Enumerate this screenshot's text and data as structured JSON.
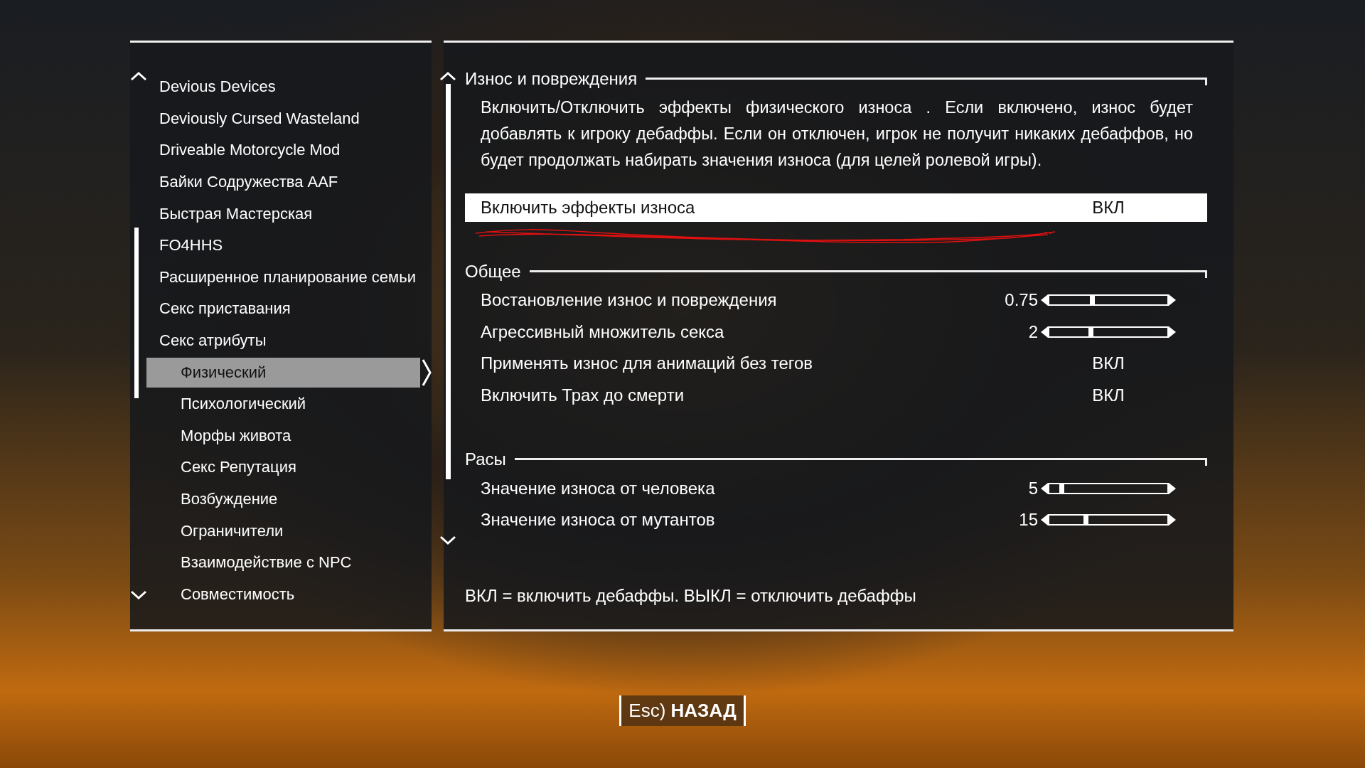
{
  "sidebar": {
    "items": [
      {
        "label": "Devious Devices",
        "selected": false
      },
      {
        "label": "Deviously Cursed Wasteland",
        "selected": false
      },
      {
        "label": "Driveable Motorcycle Mod",
        "selected": false
      },
      {
        "label": "Байки Содружества AAF",
        "selected": false
      },
      {
        "label": "Быстрая Мастерская",
        "selected": false
      },
      {
        "label": "FO4HHS",
        "selected": false
      },
      {
        "label": "Расширенное планирование семьи",
        "selected": false
      },
      {
        "label": "Секс приставания",
        "selected": false
      },
      {
        "label": "Секс атрибуты",
        "selected": false,
        "children": [
          {
            "label": "Физический",
            "selected": true
          },
          {
            "label": "Психологический",
            "selected": false
          },
          {
            "label": "Морфы живота",
            "selected": false
          },
          {
            "label": "Секс Репутация",
            "selected": false
          },
          {
            "label": "Возбуждение",
            "selected": false
          },
          {
            "label": "Ограничители",
            "selected": false
          },
          {
            "label": "Взаимодействие с NPC",
            "selected": false
          },
          {
            "label": "Совместимость",
            "selected": false
          }
        ]
      }
    ]
  },
  "settings": {
    "sections": [
      {
        "title": "Износ и повреждения",
        "description": "Включить/Отключить эффекты физического износа . Если включено, износ будет добавлять к игроку дебаффы. Если он отключен, игрок не получит никаких дебаффов, но будет продолжать набирать значения износа (для целей ролевой игры).",
        "rows": [
          {
            "kind": "toggle",
            "label": "Включить эффекты износа",
            "value": "ВКЛ",
            "selected": true
          }
        ]
      },
      {
        "title": "Общее",
        "rows": [
          {
            "kind": "slider",
            "label": "Востановление износ и повреждения",
            "value": "0.75",
            "level": 0.36,
            "selected": false
          },
          {
            "kind": "slider",
            "label": "Агрессивный множитель секса",
            "value": "2",
            "level": 0.35,
            "selected": false
          },
          {
            "kind": "toggle",
            "label": "Применять износ для анимаций без тегов",
            "value": "ВКЛ",
            "selected": false
          },
          {
            "kind": "toggle",
            "label": "Включить Трах до смерти",
            "value": "ВКЛ",
            "selected": false
          }
        ]
      },
      {
        "title": "Расы",
        "rows": [
          {
            "kind": "slider",
            "label": "Значение износа от человека",
            "value": "5",
            "level": 0.1,
            "selected": false
          },
          {
            "kind": "slider",
            "label": "Значение износа от мутантов",
            "value": "15",
            "level": 0.31,
            "selected": false
          }
        ]
      }
    ],
    "footer": "ВКЛ = включить дебаффы. ВЫКЛ = отключить дебаффы"
  },
  "back_button": "Esc) **НАЗАД**"
}
